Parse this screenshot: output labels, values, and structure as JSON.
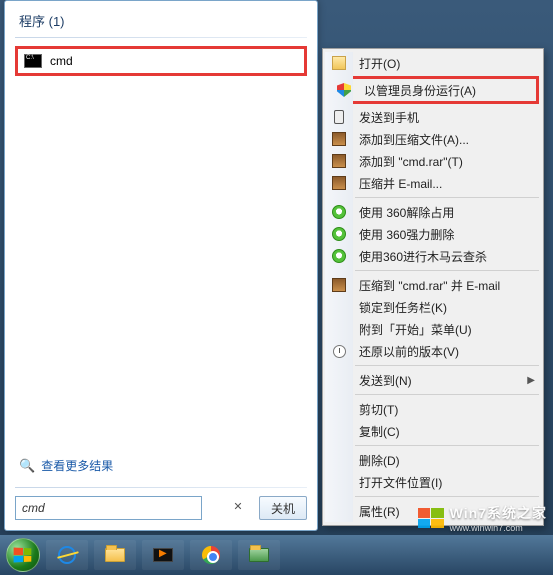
{
  "start_menu": {
    "header_label": "程序 (1)",
    "program_label": "cmd",
    "more_results": "查看更多结果",
    "search_value": "cmd",
    "shutdown_label": "关机"
  },
  "context_menu": {
    "open": "打开(O)",
    "run_as_admin": "以管理员身份运行(A)",
    "send_to_phone": "发送到手机",
    "add_to_archive": "添加到压缩文件(A)...",
    "add_to_cmd_rar": "添加到 \"cmd.rar\"(T)",
    "compress_email": "压缩并 E-mail...",
    "unlock_360": "使用 360解除占用",
    "force_delete_360": "使用 360强力删除",
    "trojan_scan_360": "使用360进行木马云查杀",
    "compress_to_cmdrar_email": "压缩到 \"cmd.rar\" 并 E-mail",
    "pin_taskbar": "锁定到任务栏(K)",
    "pin_start": "附到「开始」菜单(U)",
    "restore_versions": "还原以前的版本(V)",
    "send_to": "发送到(N)",
    "cut": "剪切(T)",
    "copy": "复制(C)",
    "delete": "删除(D)",
    "open_location": "打开文件位置(I)",
    "properties": "属性(R)"
  },
  "watermark": {
    "title": "Win7系统之家",
    "url": "www.winwin7.com"
  }
}
